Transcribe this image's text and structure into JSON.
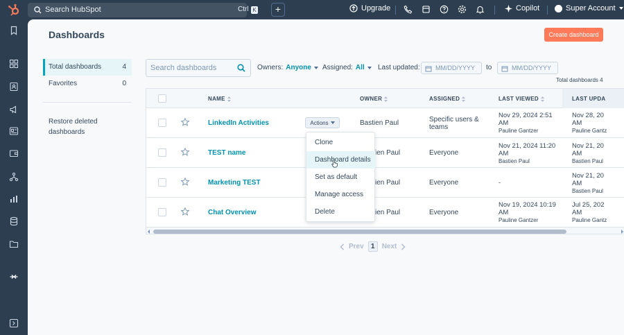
{
  "topbar": {
    "search_label": "Search HubSpot",
    "shortcut_ctrl": "Ctrl",
    "shortcut_key": "K",
    "upgrade_label": "Upgrade",
    "copilot_label": "Copilot",
    "account_label": "Super Account"
  },
  "page": {
    "title": "Dashboards",
    "create_button": "Create dashboard"
  },
  "sidebar": {
    "items": [
      {
        "label": "Total dashboards",
        "count": "4"
      },
      {
        "label": "Favorites",
        "count": "0"
      }
    ],
    "restore_label": "Restore deleted dashboards"
  },
  "filters": {
    "search_placeholder": "Search dashboards",
    "owners_label": "Owners:",
    "owners_value": "Anyone",
    "assigned_label": "Assigned:",
    "assigned_value": "All",
    "last_updated_label": "Last updated:",
    "date_placeholder": "MM/DD/YYYY",
    "to_label": "to",
    "total_text": "Total dashboards 4"
  },
  "table": {
    "columns": [
      "NAME",
      "OWNER",
      "ASSIGNED",
      "LAST VIEWED",
      "LAST UPDA"
    ],
    "actions_label": "Actions",
    "rows": [
      {
        "name": "LinkedIn Activities",
        "owner": "Bastien Paul",
        "assigned": "Specific users & teams",
        "last_viewed_date": "Nov 29, 2024 2:51 AM",
        "last_viewed_user": "Pauline Gantzer",
        "last_updated_date": "Nov 28, 20",
        "last_updated_user": "Pauline Gantz"
      },
      {
        "name": "TEST name",
        "owner": "ien Paul",
        "assigned": "Everyone",
        "last_viewed_date": "Nov 21, 2024 11:20 AM",
        "last_viewed_user": "Bastien Paul",
        "last_updated_date": "Nov 21, 20",
        "last_updated_user": "Bastien Paul"
      },
      {
        "name": "Marketing TEST",
        "owner": "ien Paul",
        "assigned": "Everyone",
        "last_viewed_date": "-",
        "last_viewed_user": "",
        "last_updated_date": "Nov 21, 20",
        "last_updated_user": "Bastien Paul"
      },
      {
        "name": "Chat Overview",
        "owner": "ien Paul",
        "assigned": "Everyone",
        "last_viewed_date": "Nov 19, 2024 10:19 AM",
        "last_viewed_user": "Pauline Gantzer",
        "last_updated_date": "Jul 25, 202",
        "last_updated_user": "Pauline Gantz"
      }
    ]
  },
  "actions_menu": {
    "items": [
      "Clone",
      "Dashboard details",
      "Set as default",
      "Manage access",
      "Delete"
    ]
  },
  "pagination": {
    "prev": "Prev",
    "current": "1",
    "next": "Next"
  },
  "colors": {
    "topbar": "#2d3e50",
    "accent": "#0091ae",
    "create_button": "#ff7a59"
  }
}
